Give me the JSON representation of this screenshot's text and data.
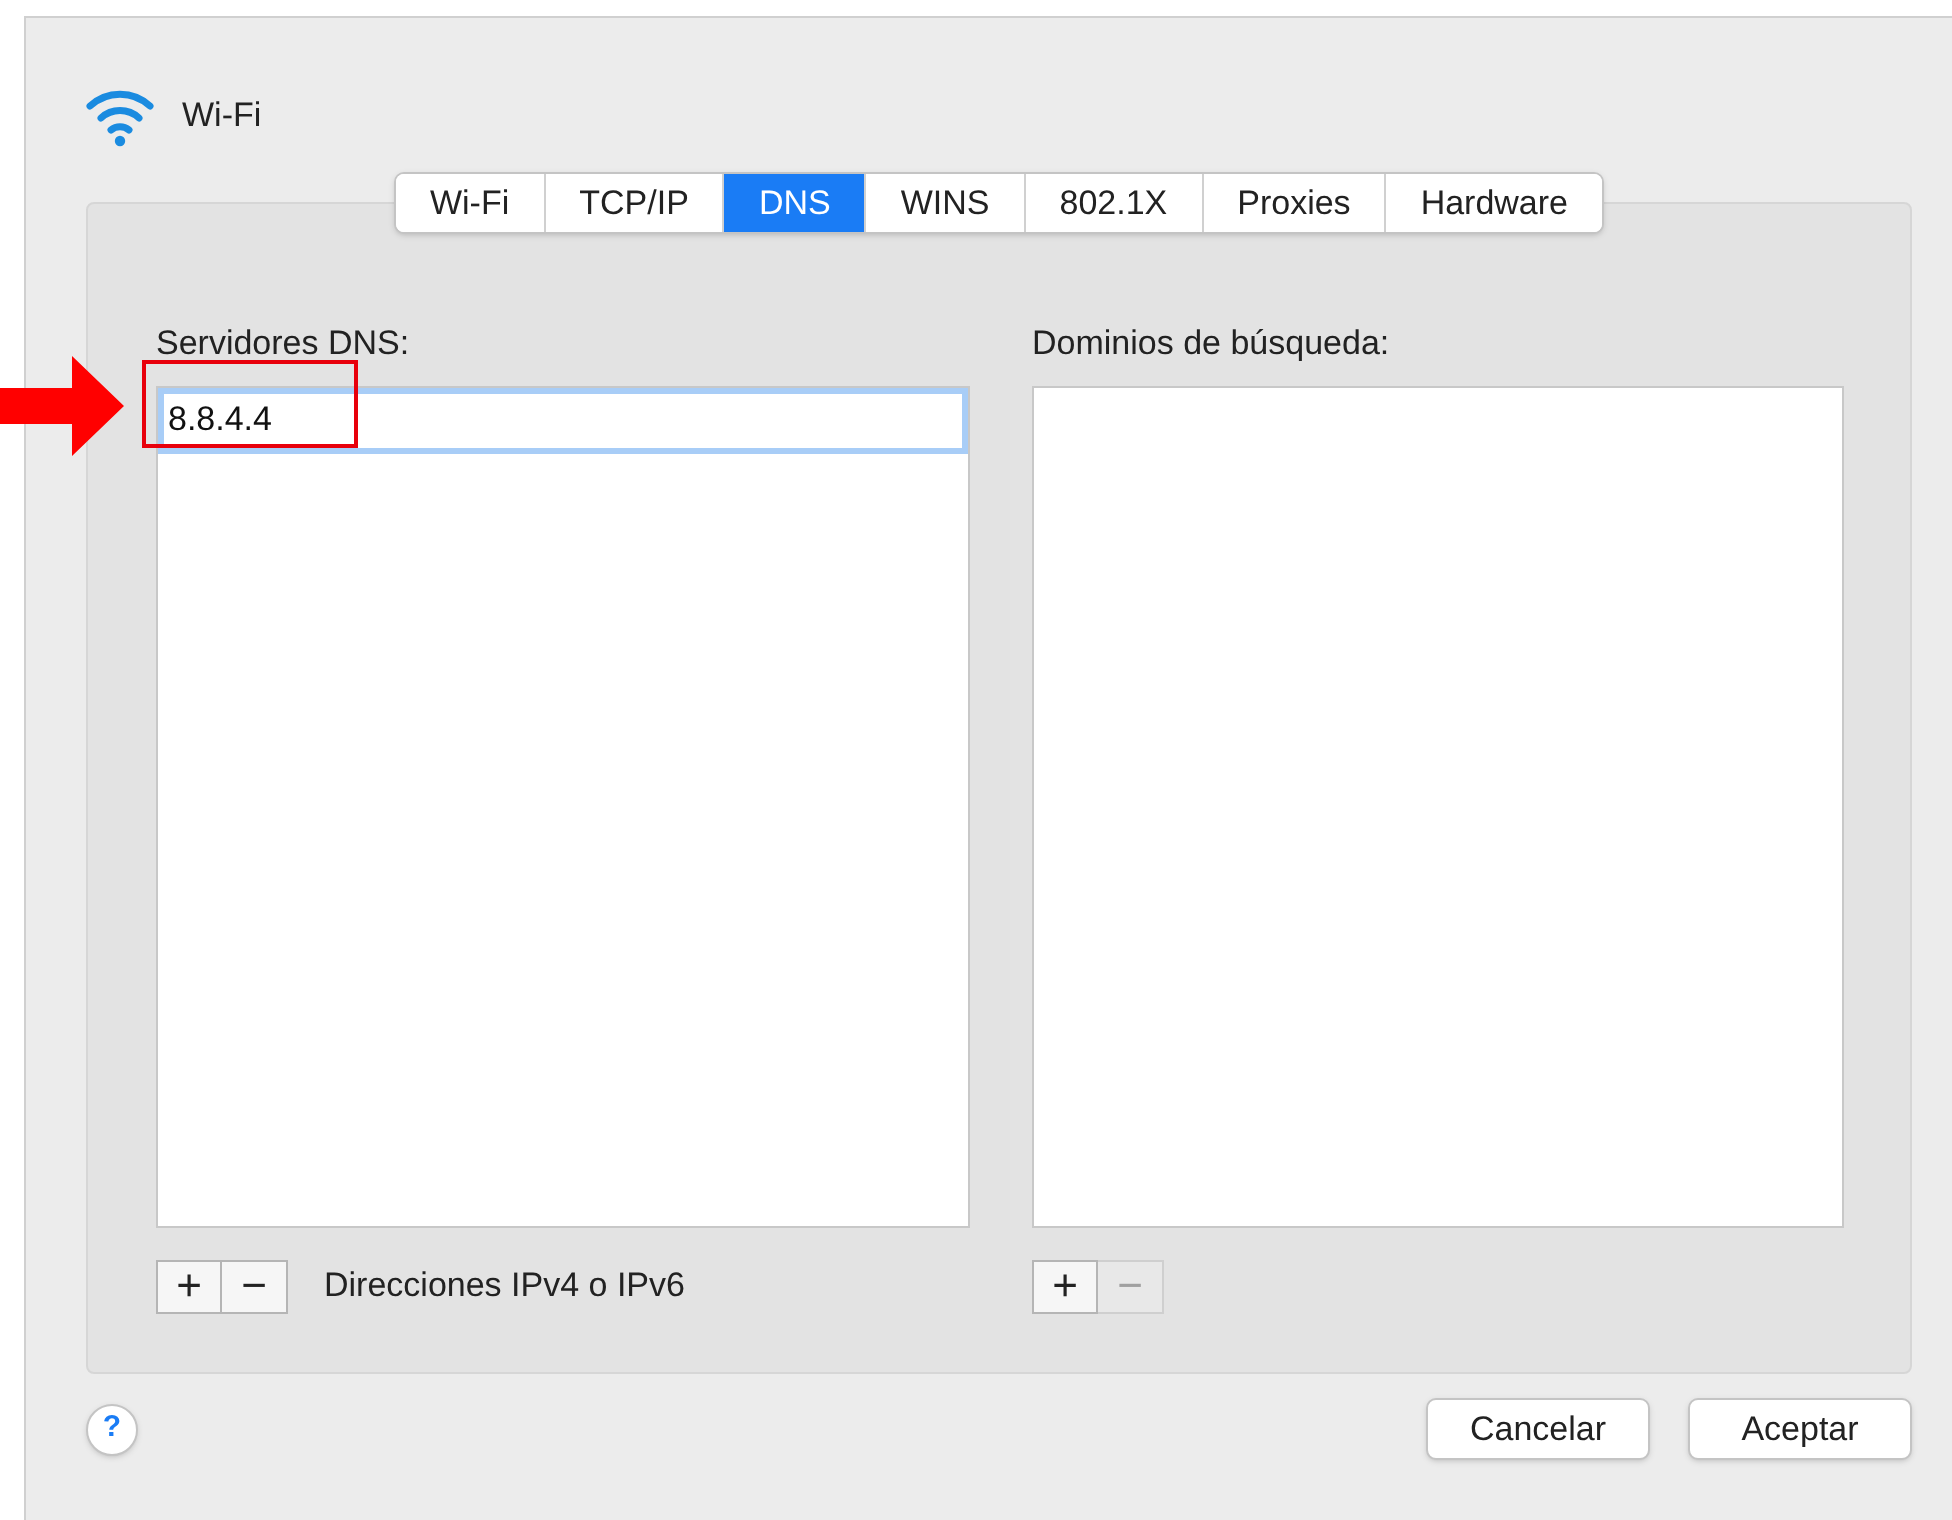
{
  "window": {
    "title": "Wi-Fi"
  },
  "tabs": [
    {
      "label": "Wi-Fi",
      "selected": false
    },
    {
      "label": "TCP/IP",
      "selected": false
    },
    {
      "label": "DNS",
      "selected": true
    },
    {
      "label": "WINS",
      "selected": false
    },
    {
      "label": "802.1X",
      "selected": false
    },
    {
      "label": "Proxies",
      "selected": false
    },
    {
      "label": "Hardware",
      "selected": false
    }
  ],
  "dns_servers": {
    "label": "Servidores DNS:",
    "entries": [
      {
        "value": "8.8.4.4",
        "editing": true
      }
    ],
    "add_button": {
      "label": "+",
      "disabled": false
    },
    "remove_button": {
      "label": "−",
      "disabled": false
    },
    "hint": "Direcciones IPv4 o IPv6"
  },
  "search_domains": {
    "label": "Dominios de búsqueda:",
    "add_button": {
      "label": "+",
      "disabled": false
    },
    "remove_button": {
      "label": "−",
      "disabled": true
    }
  },
  "help_button": {
    "label": "?"
  },
  "buttons": [
    {
      "label": "Cancelar"
    },
    {
      "label": "Aceptar"
    }
  ]
}
